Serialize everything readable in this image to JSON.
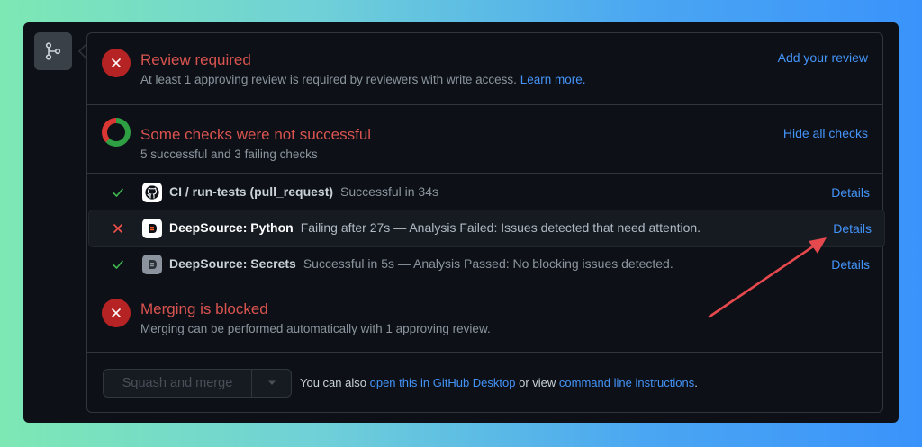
{
  "review": {
    "title": "Review required",
    "description": "At least 1 approving review is required by reviewers with write access.",
    "learn_more": "Learn more.",
    "action": "Add your review"
  },
  "checks": {
    "title": "Some checks were not successful",
    "summary": "5 successful and 3 failing checks",
    "action": "Hide all checks",
    "rows": [
      {
        "status": "success",
        "icon": "github-icon",
        "name": "CI / run-tests (pull_request)",
        "detail": "Successful in 34s",
        "link": "Details"
      },
      {
        "status": "failure",
        "icon": "deepsource-icon",
        "name": "DeepSource: Python",
        "detail": "Failing after 27s — Analysis Failed: Issues detected that need attention.",
        "link": "Details"
      },
      {
        "status": "success",
        "icon": "deepsource-icon",
        "name": "DeepSource: Secrets",
        "detail": "Successful in 5s — Analysis Passed: No blocking issues detected.",
        "link": "Details"
      }
    ]
  },
  "merge": {
    "title": "Merging is blocked",
    "description": "Merging can be performed automatically with 1 approving review."
  },
  "footer": {
    "button_label": "Squash and merge",
    "text_prefix": "You can also",
    "desktop_link": "open this in GitHub Desktop",
    "text_middle": "or view",
    "cli_link": "command line instructions",
    "text_suffix": "."
  },
  "colors": {
    "accent": "#4493f8",
    "danger": "#da3633",
    "success": "#2ea043",
    "annotation_arrow": "#e5484d"
  }
}
